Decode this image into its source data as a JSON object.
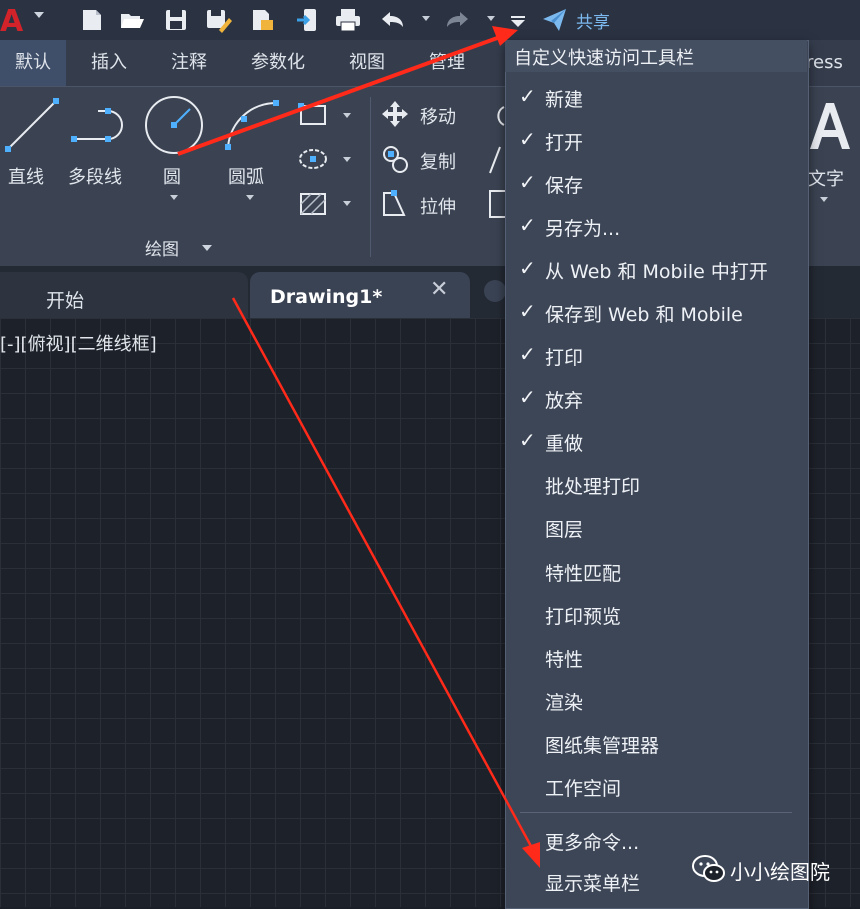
{
  "quick_access": {
    "share_label": "共享",
    "icons": [
      "app-logo",
      "new-icon",
      "open-icon",
      "save-icon",
      "save-as-icon",
      "open-web-mobile-icon",
      "save-web-mobile-icon",
      "print-icon",
      "undo-icon",
      "redo-icon",
      "customize-dropdown-icon",
      "share-icon"
    ]
  },
  "app": {
    "logo_text": "A"
  },
  "tabs": [
    {
      "label": "默认",
      "active": true
    },
    {
      "label": "插入"
    },
    {
      "label": "注释"
    },
    {
      "label": "参数化"
    },
    {
      "label": "视图"
    },
    {
      "label": "管理"
    },
    {
      "label": "ress"
    }
  ],
  "ribbon": {
    "draw": {
      "line": "直线",
      "polyline": "多段线",
      "circle": "圆",
      "arc": "圆弧",
      "panel_title": "绘图"
    },
    "modify": {
      "move": "移动",
      "copy": "复制",
      "stretch": "拉伸"
    },
    "annotation": {
      "text": "文字"
    }
  },
  "doc_tabs": {
    "start": "开始",
    "drawing": "Drawing1*"
  },
  "viewport": {
    "label": "[-][俯视][二维线框]"
  },
  "menu": {
    "title": "自定义快速访问工具栏",
    "items": [
      {
        "label": "新建",
        "checked": true
      },
      {
        "label": "打开",
        "checked": true
      },
      {
        "label": "保存",
        "checked": true
      },
      {
        "label": "另存为...",
        "checked": true
      },
      {
        "label": "从 Web 和 Mobile 中打开",
        "checked": true
      },
      {
        "label": "保存到 Web 和 Mobile",
        "checked": true
      },
      {
        "label": "打印",
        "checked": true
      },
      {
        "label": "放弃",
        "checked": true
      },
      {
        "label": "重做",
        "checked": true
      },
      {
        "label": "批处理打印",
        "checked": false
      },
      {
        "label": "图层",
        "checked": false
      },
      {
        "label": "特性匹配",
        "checked": false
      },
      {
        "label": "打印预览",
        "checked": false
      },
      {
        "label": "特性",
        "checked": false
      },
      {
        "label": "渲染",
        "checked": false
      },
      {
        "label": "图纸集管理器",
        "checked": false
      },
      {
        "label": "工作空间",
        "checked": false
      },
      {
        "label": "更多命令...",
        "checked": false
      },
      {
        "label": "显示菜单栏",
        "checked": false
      }
    ],
    "check_glyph": "✓"
  },
  "watermark": {
    "text": "小小绘图院"
  },
  "colors": {
    "accent_arrow": "#ff2a1a",
    "share_blue": "#7cb9ef",
    "menu_bg": "#3d4657",
    "logo_red": "#d2222a"
  }
}
